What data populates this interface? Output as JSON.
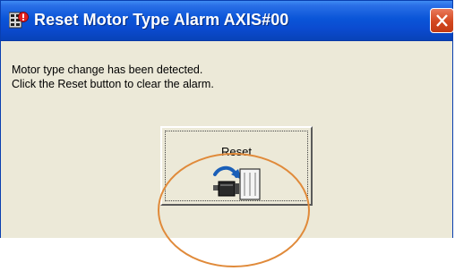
{
  "window": {
    "title": "Reset Motor Type Alarm AXIS#00",
    "title_icon": "alarm-reset-icon",
    "close_icon": "close-icon"
  },
  "message": {
    "line1": "Motor type change has been detected.",
    "line2": "Click the Reset button to clear the alarm."
  },
  "reset_button": {
    "label": "Reset",
    "icon": "motor-reset-icon"
  },
  "colors": {
    "titlebar": "#0a55d8",
    "dialog_bg": "#ece9d8",
    "close_button": "#d3471f",
    "highlight_ellipse": "#e08a3a"
  }
}
